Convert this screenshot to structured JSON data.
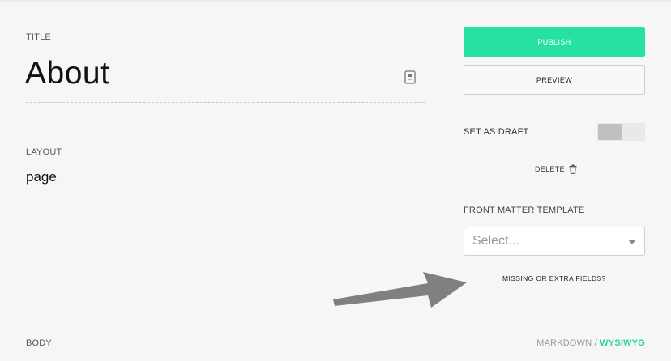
{
  "fields": {
    "title_label": "TITLE",
    "title_value": "About",
    "layout_label": "LAYOUT",
    "layout_value": "page",
    "body_label": "BODY"
  },
  "sidebar": {
    "publish_label": "PUBLISH",
    "preview_label": "PREVIEW",
    "draft_label": "SET AS DRAFT",
    "draft_enabled": false,
    "delete_label": "DELETE",
    "front_matter_label": "FRONT MATTER TEMPLATE",
    "front_matter_placeholder": "Select...",
    "missing_fields_label": "MISSING OR EXTRA FIELDS?"
  },
  "editor_mode": {
    "markdown_label": "MARKDOWN",
    "separator": " / ",
    "wysiwyg_label": "WYSIWYG",
    "active": "WYSIWYG"
  },
  "icons": {
    "title_field_icon": "document-icon",
    "delete_icon": "trash-icon",
    "select_caret": "chevron-down-icon",
    "annotation": "arrow-icon"
  },
  "colors": {
    "accent": "#27e1a0",
    "wysiwyg_active": "#27d6a0",
    "background": "#f6f6f6"
  }
}
